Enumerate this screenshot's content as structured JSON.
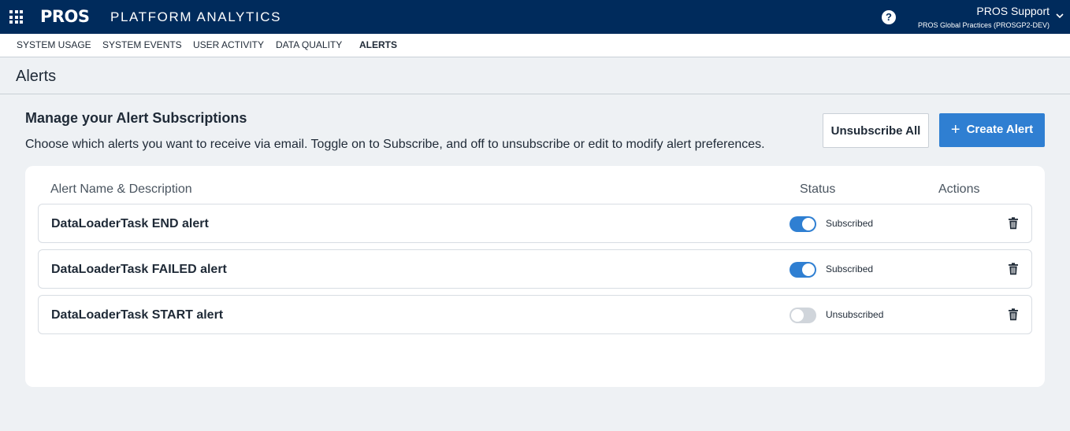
{
  "header": {
    "logo": "PROS",
    "app_title": "PLATFORM ANALYTICS",
    "help_icon": "question-circle-icon",
    "help_glyph": "?",
    "user_name": "PROS Support",
    "user_org": "PROS Global Practices (PROSGP2-DEV)",
    "brand_color": "#002b5c"
  },
  "nav": {
    "tabs": [
      {
        "label": "SYSTEM USAGE",
        "active": false
      },
      {
        "label": "SYSTEM EVENTS",
        "active": false
      },
      {
        "label": "USER ACTIVITY",
        "active": false
      },
      {
        "label": "DATA QUALITY",
        "active": false
      },
      {
        "label": "ALERTS",
        "active": true
      }
    ]
  },
  "page": {
    "title": "Alerts",
    "section_title": "Manage your Alert Subscriptions",
    "section_desc": "Choose which alerts you want to receive via email. Toggle on to Subscribe, and off to unsubscribe or edit to modify alert preferences.",
    "unsubscribe_all_label": "Unsubscribe All",
    "create_alert_plus": "+",
    "create_alert_label": "Create Alert",
    "accent_color": "#2f7fd2"
  },
  "table": {
    "columns": {
      "name": "Alert Name & Description",
      "status": "Status",
      "actions": "Actions"
    },
    "rows": [
      {
        "name": "DataLoaderTask END alert",
        "subscribed": true,
        "status": "Subscribed",
        "action_icon": "trash-icon"
      },
      {
        "name": "DataLoaderTask FAILED alert",
        "subscribed": true,
        "status": "Subscribed",
        "action_icon": "trash-icon"
      },
      {
        "name": "DataLoaderTask START alert",
        "subscribed": false,
        "status": "Unsubscribed",
        "action_icon": "trash-icon"
      }
    ]
  }
}
